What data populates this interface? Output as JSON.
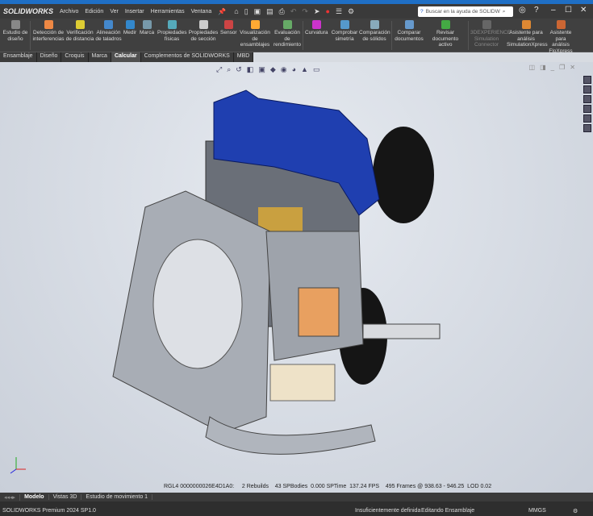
{
  "app": {
    "logo": "SOLIDWORKS"
  },
  "menu": [
    "Archivo",
    "Edición",
    "Ver",
    "Insertar",
    "Herramientas",
    "Ventana"
  ],
  "search": {
    "placeholder": "Buscar en la ayuda de SOLIDW"
  },
  "ribbon": [
    {
      "label": "Estudio de diseño",
      "color": "#888"
    },
    {
      "label": "Detección de interferencias",
      "color": "#e84"
    },
    {
      "label": "Verificación de distancia",
      "color": "#dc3"
    },
    {
      "label": "Alineación de taladros",
      "color": "#48c"
    },
    {
      "label": "Medir",
      "color": "#38c"
    },
    {
      "label": "Marca",
      "color": "#79a"
    },
    {
      "label": "Propiedades físicas",
      "color": "#5ab"
    },
    {
      "label": "Propiedades de sección",
      "color": "#ccc"
    },
    {
      "label": "Sensor",
      "color": "#c44"
    },
    {
      "label": "Visualización de ensamblajes",
      "color": "#fa3"
    },
    {
      "label": "Evaluación de rendimiento",
      "color": "#6a6"
    },
    {
      "label": "Curvatura",
      "color": "#c3c"
    },
    {
      "label": "Comprobar simetría",
      "color": "#59c"
    },
    {
      "label": "Comparación de sólidos",
      "color": "#8ab"
    },
    {
      "label": "Comparar documentos",
      "color": "#69c"
    },
    {
      "label": "Revisar documento activo",
      "color": "#4a4"
    },
    {
      "label": "3DEXPERIENCE Simulation Connector",
      "color": "#666"
    },
    {
      "label": "Asistente para análisis SimulationXpress",
      "color": "#d83"
    },
    {
      "label": "Asistente para análisis FloXpress",
      "color": "#c63"
    }
  ],
  "tabs": [
    "Ensamblaje",
    "Diseño",
    "Croquis",
    "Marca",
    "Calcular",
    "Complementos de SOLIDWORKS",
    "MBD"
  ],
  "active_tab": "Calcular",
  "stats": "RGL4 0000000026E4D1A0:     2 Rebuilds    43 SPBodies  0.000 SPTime  137.24 FPS    495 Frames @ 938.63 - 946.25  LOD 0.02",
  "bottom_tabs": [
    "Modelo",
    "Vistas 3D",
    "Estudio de movimiento 1"
  ],
  "status": {
    "product": "SOLIDWORKS Premium 2024 SP1.0",
    "definition": "Insuficientemente definida",
    "mode": "Editando Ensamblaje",
    "units": "MMGS"
  }
}
